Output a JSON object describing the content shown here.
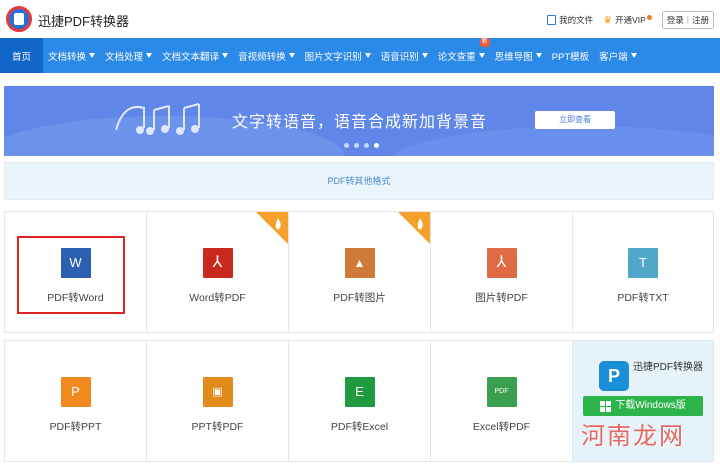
{
  "header": {
    "brand": "迅捷PDF转换器",
    "my_files": "我的文件",
    "vip": "开通VIP",
    "login": "登录",
    "register": "注册"
  },
  "nav": {
    "items": [
      {
        "label": "首页",
        "dropdown": false,
        "active": true
      },
      {
        "label": "文档转换",
        "dropdown": true
      },
      {
        "label": "文档处理",
        "dropdown": true
      },
      {
        "label": "文档文本翻译",
        "dropdown": true
      },
      {
        "label": "音视频转换",
        "dropdown": true
      },
      {
        "label": "图片文字识别",
        "dropdown": true
      },
      {
        "label": "语音识别",
        "dropdown": true
      },
      {
        "label": "论文查重",
        "dropdown": true,
        "badge": "新"
      },
      {
        "label": "思维导图",
        "dropdown": true
      },
      {
        "label": "PPT模板",
        "dropdown": false
      },
      {
        "label": "客户端",
        "dropdown": true
      }
    ]
  },
  "banner": {
    "text": "文字转语音，语音合成新加背景音",
    "button": "立即查看"
  },
  "section": {
    "label": "PDF转其他格式"
  },
  "tools": [
    {
      "label": "PDF转Word",
      "icon": "word-icon",
      "glyph": "W",
      "color": "#2b5faf"
    },
    {
      "label": "Word转PDF",
      "icon": "pdf-icon",
      "glyph": "⤴",
      "color": "#c8281e"
    },
    {
      "label": "PDF转图片",
      "icon": "image-icon",
      "glyph": "▲",
      "color": "#d07a3a"
    },
    {
      "label": "图片转PDF",
      "icon": "pdf-icon",
      "glyph": "⤴",
      "color": "#e06a43"
    },
    {
      "label": "PDF转TXT",
      "icon": "txt-icon",
      "glyph": "T",
      "color": "#4fa8c8"
    },
    {
      "label": "PDF转PPT",
      "icon": "ppt-icon",
      "glyph": "P",
      "color": "#f08a1e"
    },
    {
      "label": "PPT转PDF",
      "icon": "ppt-icon",
      "glyph": "P",
      "color": "#e28a1a"
    },
    {
      "label": "PDF转Excel",
      "icon": "excel-icon",
      "glyph": "E",
      "color": "#1f9a3f"
    },
    {
      "label": "Excel转PDF",
      "icon": "excel-icon",
      "glyph": "PDF",
      "color": "#3aa050"
    }
  ],
  "download": {
    "name": "迅捷PDF转换器",
    "button": "下载Windows版"
  },
  "watermark": "河南龙网"
}
